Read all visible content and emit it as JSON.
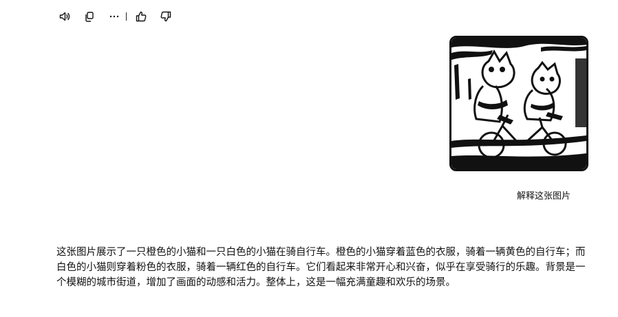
{
  "toolbar": {
    "icons": [
      "speaker-icon",
      "copy-icon",
      "more-icon",
      "thumbs-up-icon",
      "thumbs-down-icon"
    ]
  },
  "image_card": {
    "explain_label": "解释这张图片"
  },
  "answer": {
    "text": "这张图片展示了一只橙色的小猫和一只白色的小猫在骑自行车。橙色的小猫穿着蓝色的衣服，骑着一辆黄色的自行车；而白色的小猫则穿着粉色的衣服，骑着一辆红色的自行车。它们看起来非常开心和兴奋，似乎在享受骑行的乐趣。背景是一个模糊的城市街道，增加了画面的动感和活力。整体上，这是一幅充满童趣和欢乐的场景。"
  },
  "colors": {
    "text": "#111111",
    "background": "#ffffff"
  }
}
